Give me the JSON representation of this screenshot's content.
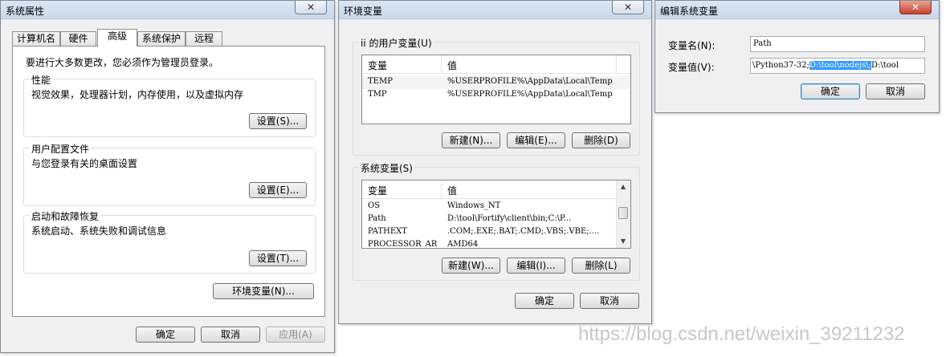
{
  "sys_props": {
    "title": "系统属性",
    "close": "✕",
    "tabs": [
      "计算机名",
      "硬件",
      "高级",
      "系统保护",
      "远程"
    ],
    "admin_note": "要进行大多数更改，您必须作为管理员登录。",
    "perf": {
      "title": "性能",
      "desc": "视觉效果，处理器计划，内存使用，以及虚拟内存",
      "btn": "设置(S)..."
    },
    "profile": {
      "title": "用户配置文件",
      "desc": "与您登录有关的桌面设置",
      "btn": "设置(E)..."
    },
    "startup": {
      "title": "启动和故障恢复",
      "desc": "系统启动、系统失败和调试信息",
      "btn": "设置(T)..."
    },
    "env_btn": "环境变量(N)...",
    "ok": "确定",
    "cancel": "取消",
    "apply": "应用(A)"
  },
  "env_vars": {
    "title": "环境变量",
    "close": "✕",
    "user_group": "ii 的用户变量(U)",
    "col_var": "变量",
    "col_val": "值",
    "user_rows": [
      {
        "name": "TEMP",
        "value": "%USERPROFILE%\\AppData\\Local\\Temp"
      },
      {
        "name": "TMP",
        "value": "%USERPROFILE%\\AppData\\Local\\Temp"
      }
    ],
    "user_btns": {
      "new": "新建(N)...",
      "edit": "编辑(E)...",
      "delete": "删除(D)"
    },
    "sys_group": "系统变量(S)",
    "sys_rows": [
      {
        "name": "OS",
        "value": "Windows_NT"
      },
      {
        "name": "Path",
        "value": "D:\\tool\\Fortify\\client\\bin;C:\\P..."
      },
      {
        "name": "PATHEXT",
        "value": ".COM;.EXE;.BAT;.CMD;.VBS;.VBE;...."
      },
      {
        "name": "PROCESSOR_AR",
        "value": "AMD64"
      }
    ],
    "sys_btns": {
      "new": "新建(W)...",
      "edit": "编辑(I)...",
      "delete": "删除(L)"
    },
    "ok": "确定",
    "cancel": "取消"
  },
  "edit_var": {
    "title": "编辑系统变量",
    "close": "✕",
    "name_label": "变量名(N):",
    "value_label": "变量值(V):",
    "name_value": "Path",
    "value_before": "\\Python37-32;",
    "value_selected": "D:\\tool\\nodejs\\;",
    "value_after": "D:\\tool",
    "ok": "确定",
    "cancel": "取消"
  },
  "watermark": "https://blog.csdn.net/weixin_39211232",
  "colors": {
    "selection": "#3399ff",
    "window_bg": "#f0f0f0",
    "close_red": "#c9412e"
  }
}
